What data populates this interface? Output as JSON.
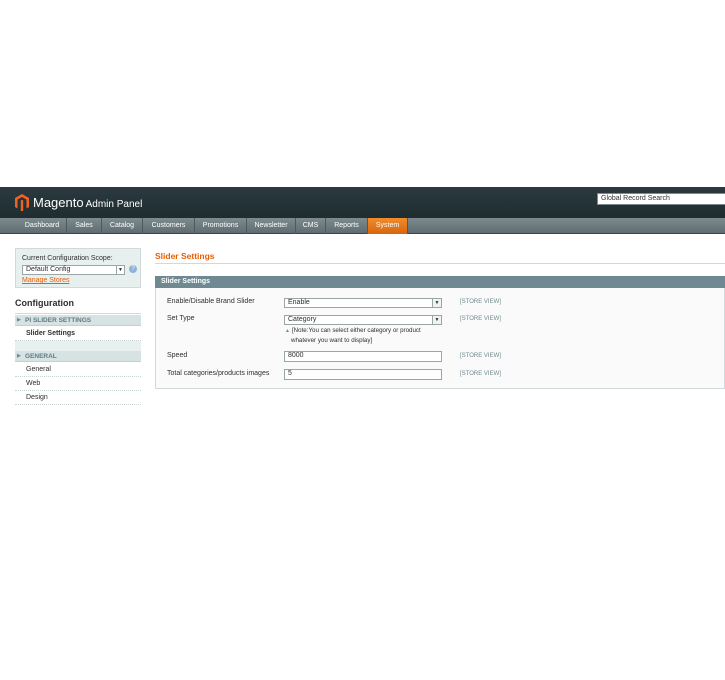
{
  "header": {
    "brand": "Magento",
    "subtitle": "Admin Panel",
    "search_placeholder": "Global Record Search"
  },
  "nav": [
    {
      "label": "Dashboard",
      "active": false
    },
    {
      "label": "Sales",
      "active": false
    },
    {
      "label": "Catalog",
      "active": false
    },
    {
      "label": "Customers",
      "active": false
    },
    {
      "label": "Promotions",
      "active": false
    },
    {
      "label": "Newsletter",
      "active": false
    },
    {
      "label": "CMS",
      "active": false
    },
    {
      "label": "Reports",
      "active": false
    },
    {
      "label": "System",
      "active": true
    }
  ],
  "sidebar": {
    "scope_label": "Current Configuration Scope:",
    "scope_value": "Default Config",
    "manage_stores": "Manage Stores",
    "config_title": "Configuration",
    "sections": [
      {
        "title": "PI SLIDER SETTINGS",
        "items": [
          "Slider Settings"
        ]
      },
      {
        "title": "GENERAL",
        "items": [
          "General",
          "Web",
          "Design"
        ]
      }
    ]
  },
  "main": {
    "page_title": "Slider Settings",
    "fieldset_title": "Slider Settings",
    "rows": [
      {
        "label": "Enable/Disable Brand Slider",
        "value": "Enable",
        "type": "select",
        "scope": "[STORE VIEW]"
      },
      {
        "label": "Set Type",
        "value": "Category",
        "type": "select",
        "scope": "[STORE VIEW]"
      },
      {
        "label": "Speed",
        "value": "8000",
        "type": "text",
        "scope": "[STORE VIEW]"
      },
      {
        "label": "Total categories/products images",
        "value": "5",
        "type": "text",
        "scope": "[STORE VIEW]"
      }
    ],
    "note_line1": "[Note:You can select either category or product",
    "note_line2": "whatever you want to display]"
  },
  "colors": {
    "header_bg": "#2b3a3f",
    "accent_orange": "#eb5e00",
    "nav_active": "#e67415",
    "fieldset_head": "#6f8992"
  }
}
